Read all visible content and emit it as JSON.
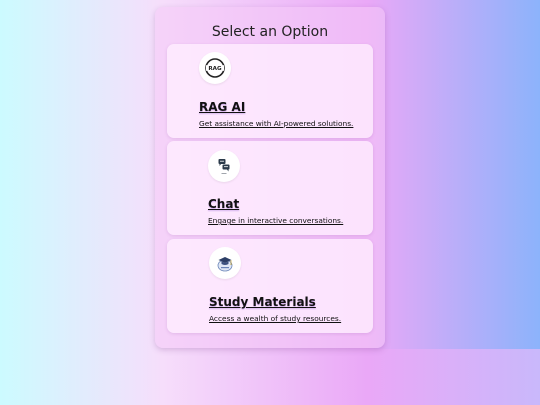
{
  "page": {
    "title": "Select an Option"
  },
  "options": [
    {
      "title": "RAG AI",
      "description": "Get assistance with AI-powered solutions.",
      "icon": "rag-logo-icon",
      "logo_text": "RAG"
    },
    {
      "title": "Chat",
      "description": "Engage in interactive conversations.",
      "icon": "chat-icon"
    },
    {
      "title": "Study Materials",
      "description": "Access a wealth of study resources.",
      "icon": "graduation-cap-icon"
    }
  ],
  "colors": {
    "panel": "#f4c8f7",
    "card": "#ffeeff",
    "text": "#111111"
  }
}
